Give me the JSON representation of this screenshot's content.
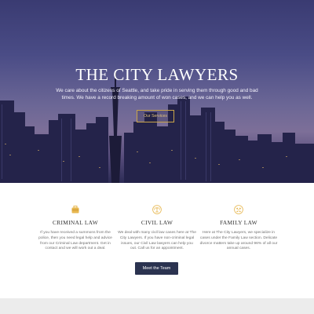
{
  "hero": {
    "title": "THE CITY LAWYERS",
    "subtitle": "We care about the citizens of Seattle, and take pride in serving them through good and bad times. We have a record breaking amount of won cases, and we can help you as well.",
    "button_label": "Our Services"
  },
  "services": [
    {
      "icon": "briefcase-icon",
      "title": "CRIMINAL LAW",
      "text": "If you have received a summons from the police, then you need legal help and advice from our Criminal Law department. Get in contact and we will work out a deal."
    },
    {
      "icon": "scales-icon",
      "title": "CIVIL LAW",
      "text": "We deal with many civil law cases here at The City Lawyers. If you have non-criminal legal issues, our Civil Law lawyers can help you out. Call us for an appointment."
    },
    {
      "icon": "family-icon",
      "title": "FAMILY LAW",
      "text": "Here at The City Lawyers, we specialize in cases under the Family Law section. Delicate divorce matters take up around 96% of all our annual cases."
    }
  ],
  "team_button_label": "Meet the Team",
  "colors": {
    "accent_gold": "#c9a44a",
    "button_dark": "#2b3350",
    "hero_top": "#3a3b72"
  }
}
